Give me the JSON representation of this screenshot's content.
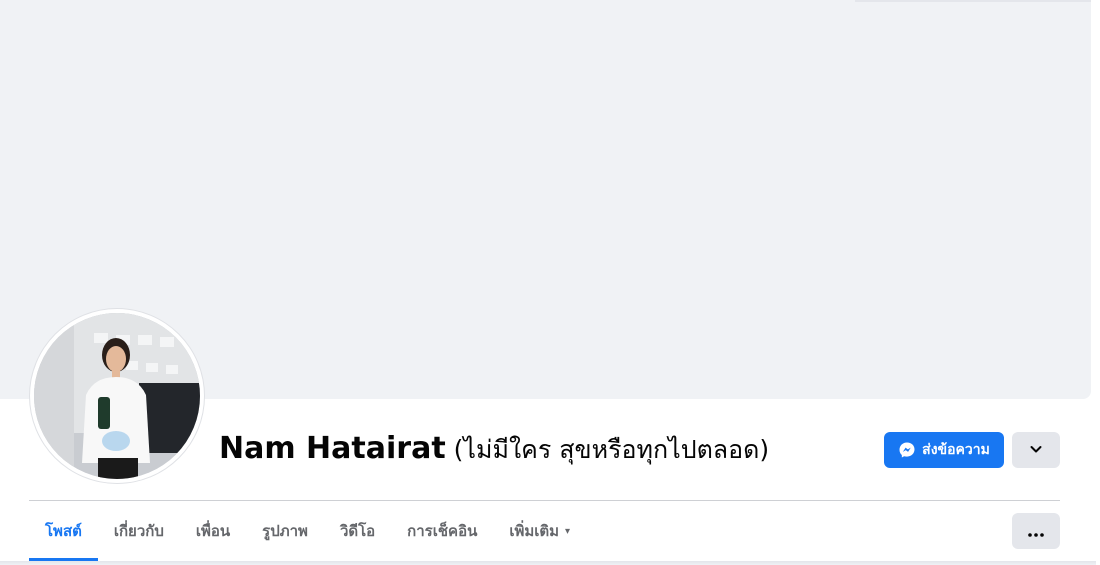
{
  "profile": {
    "name": "Nam Hatairat",
    "alternate_name": "(ไม่มีใคร สุขหรือทุกไปตลอด)"
  },
  "actions": {
    "message_label": "ส่งข้อความ",
    "message_icon": "messenger-icon",
    "dropdown_icon": "chevron-down-icon",
    "more_icon": "more-horizontal-icon"
  },
  "tabs": [
    {
      "label": "โพสต์",
      "active": true
    },
    {
      "label": "เกี่ยวกับ"
    },
    {
      "label": "เพื่อน"
    },
    {
      "label": "รูปภาพ"
    },
    {
      "label": "วิดีโอ"
    },
    {
      "label": "การเช็คอิน"
    },
    {
      "label": "เพิ่มเติม",
      "caret": "▾"
    }
  ],
  "colors": {
    "accent": "#1877f2",
    "cover_bg": "#f0f2f5",
    "secondary_button": "#e4e6eb",
    "tab_text": "#65676b"
  }
}
